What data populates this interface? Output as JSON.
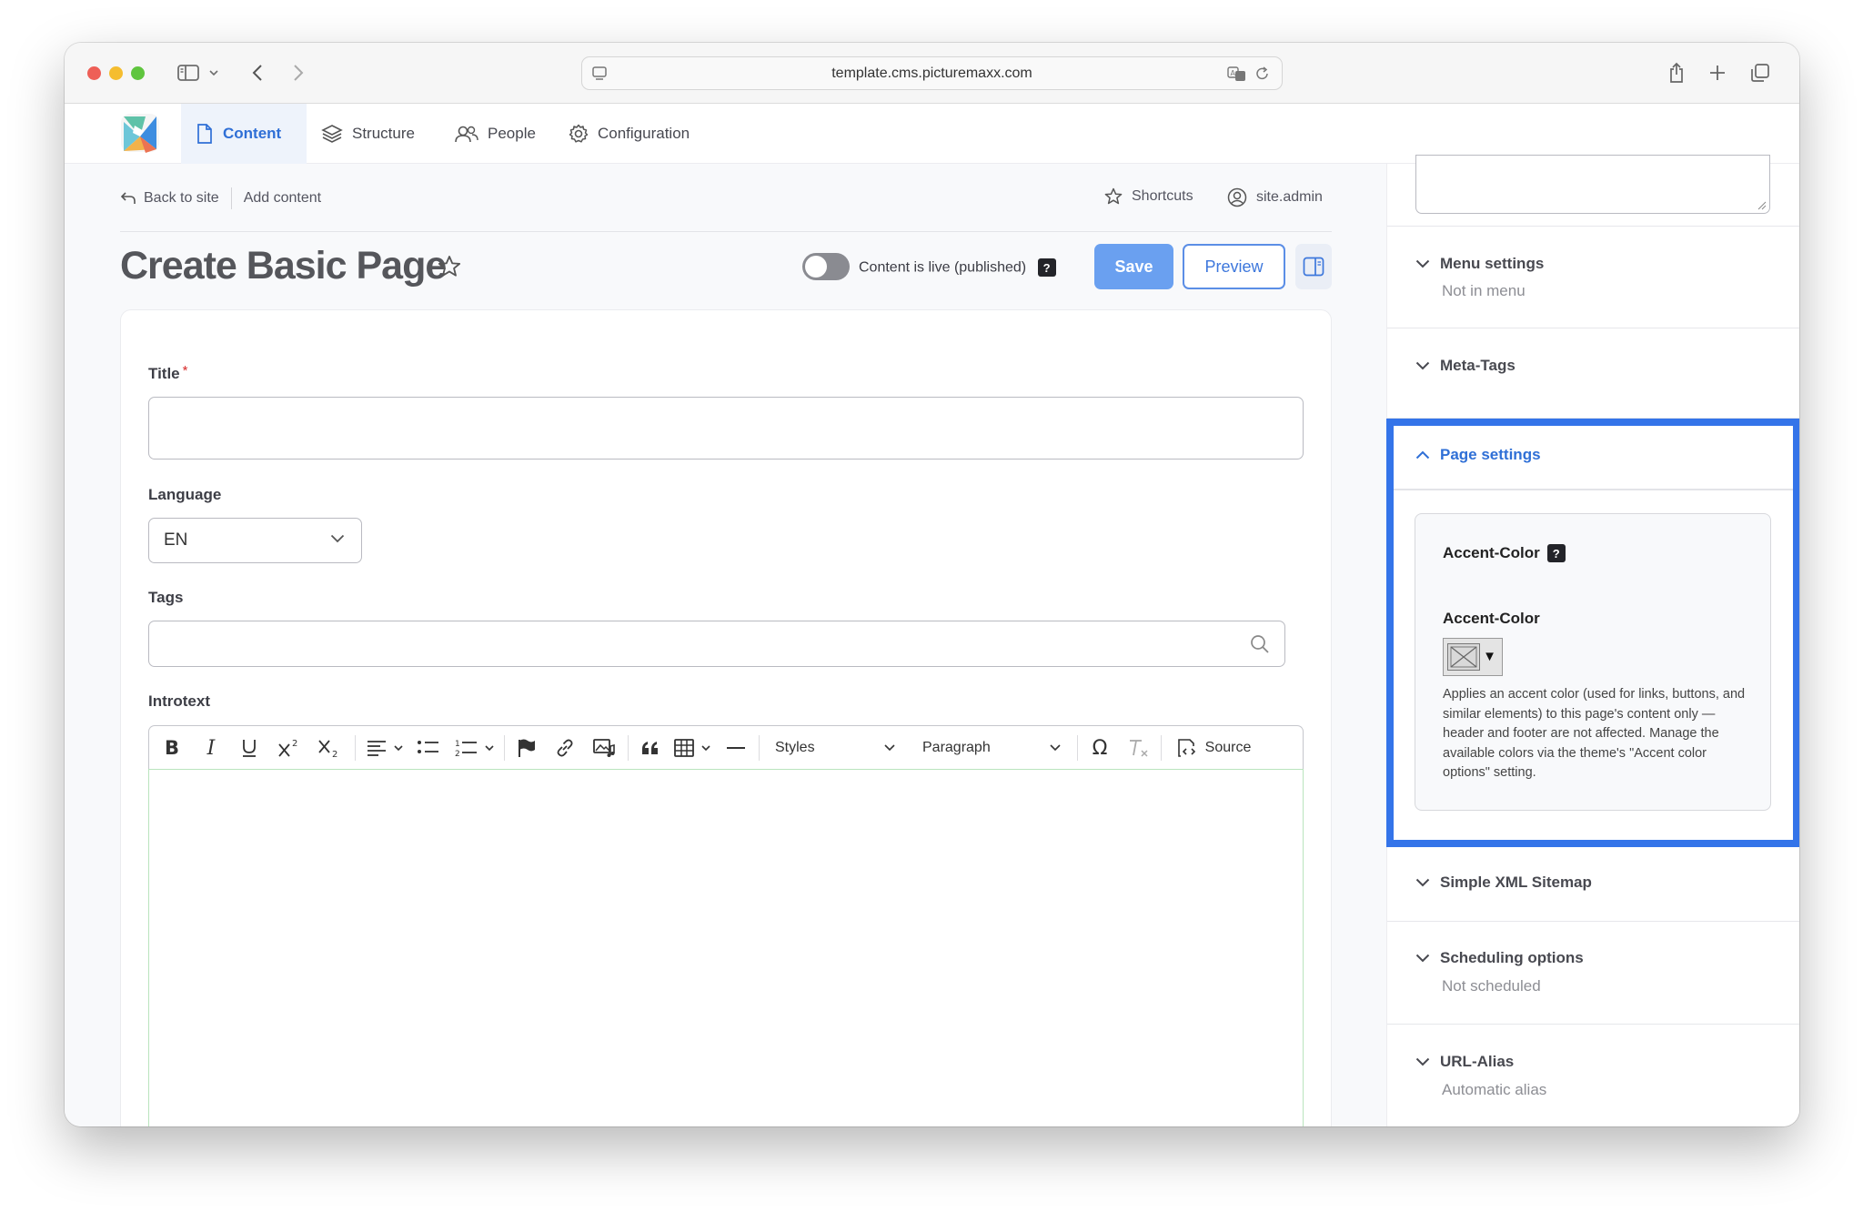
{
  "browser": {
    "url": "template.cms.picturemaxx.com"
  },
  "nav": {
    "items": [
      {
        "label": "Content",
        "icon": "file-icon",
        "active": true
      },
      {
        "label": "Structure",
        "icon": "layers-icon",
        "active": false
      },
      {
        "label": "People",
        "icon": "people-icon",
        "active": false
      },
      {
        "label": "Configuration",
        "icon": "gear-icon",
        "active": false
      }
    ]
  },
  "breadcrumb": {
    "back": "Back to site",
    "current": "Add content"
  },
  "topbar": {
    "shortcuts": "Shortcuts",
    "user": "site.admin"
  },
  "page": {
    "title": "Create Basic Page",
    "live_label": "Content is live (published)",
    "help": "?",
    "save": "Save",
    "preview": "Preview"
  },
  "form": {
    "title_label": "Title",
    "required_mark": "*",
    "title_value": "",
    "language_label": "Language",
    "language_value": "EN",
    "tags_label": "Tags",
    "tags_value": "",
    "introtext_label": "Introtext"
  },
  "editor_toolbar": {
    "styles": "Styles",
    "paragraph": "Paragraph",
    "source": "Source"
  },
  "sidebar": {
    "menu_settings": {
      "title": "Menu settings",
      "summary": "Not in menu"
    },
    "meta_tags": {
      "title": "Meta-Tags"
    },
    "page_settings": {
      "title": "Page settings",
      "group_label": "Accent-Color",
      "help": "?",
      "field_label": "Accent-Color",
      "swatch_arrow": "▼",
      "description": "Applies an accent color (used for links, but­tons, and similar elements) to this page's content only — header and footer are not affected. Manage the available colors via the theme's \"Accent color options\" setting."
    },
    "sitemap": {
      "title": "Simple XML Sitemap"
    },
    "scheduling": {
      "title": "Scheduling options",
      "summary": "Not scheduled"
    },
    "url_alias": {
      "title": "URL-Alias",
      "summary": "Automatic alias"
    }
  },
  "colors": {
    "accent": "#2f6fd6",
    "highlight_border": "#3474e9",
    "save_button": "#6aa0f0"
  }
}
